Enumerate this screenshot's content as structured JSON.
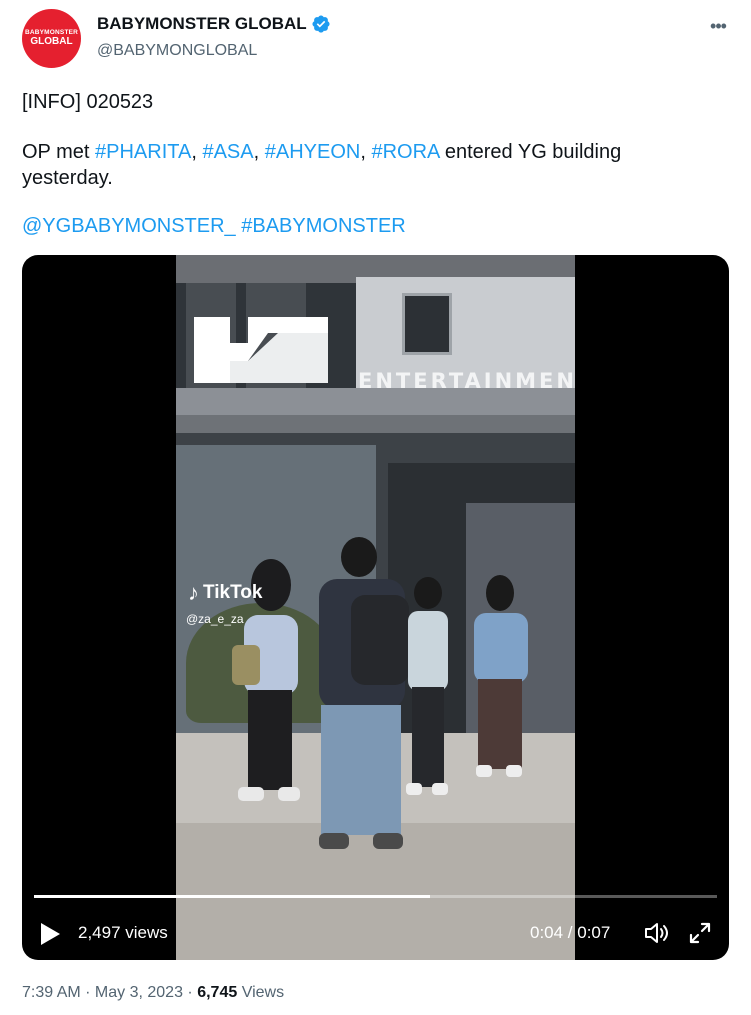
{
  "author": {
    "avatar_line1": "BABYMONSTER",
    "avatar_line2": "GLOBAL",
    "display_name": "BABYMONSTER GLOBAL",
    "handle": "@BABYMONGLOBAL",
    "verified_icon": "verified-badge-icon"
  },
  "more_icon": "more-options-icon",
  "tweet": {
    "line1": "[INFO] 020523",
    "line2_prefix": "OP met ",
    "hashtag1": "#PHARITA",
    "sep1": ", ",
    "hashtag2": "#ASA",
    "sep2": ", ",
    "hashtag3": "#AHYEON",
    "sep3": ", ",
    "hashtag4": "#RORA",
    "line2_suffix": " entered YG building",
    "line3": "yesterday.",
    "mention": "@YGBABYMONSTER_",
    "hashtag5": "#BABYMONSTER"
  },
  "video": {
    "sign_text": "ENTERTAINMEN",
    "watermark_brand": "TikTok",
    "watermark_user": "@za_e_za",
    "views": "2,497 views",
    "time": "0:04 / 0:07",
    "progress": 0.58,
    "play_icon": "play-icon",
    "volume_icon": "volume-icon",
    "fullscreen_icon": "fullscreen-icon"
  },
  "meta": {
    "time": "7:39 AM",
    "dot": " · ",
    "date": "May 3, 2023",
    "dot2": " · ",
    "views_count": "6,745",
    "views_label": " Views"
  },
  "colors": {
    "link": "#1d9bf0",
    "verified": "#1d9bf0",
    "avatar_bg": "#e5202f",
    "secondary_text": "#536471"
  }
}
